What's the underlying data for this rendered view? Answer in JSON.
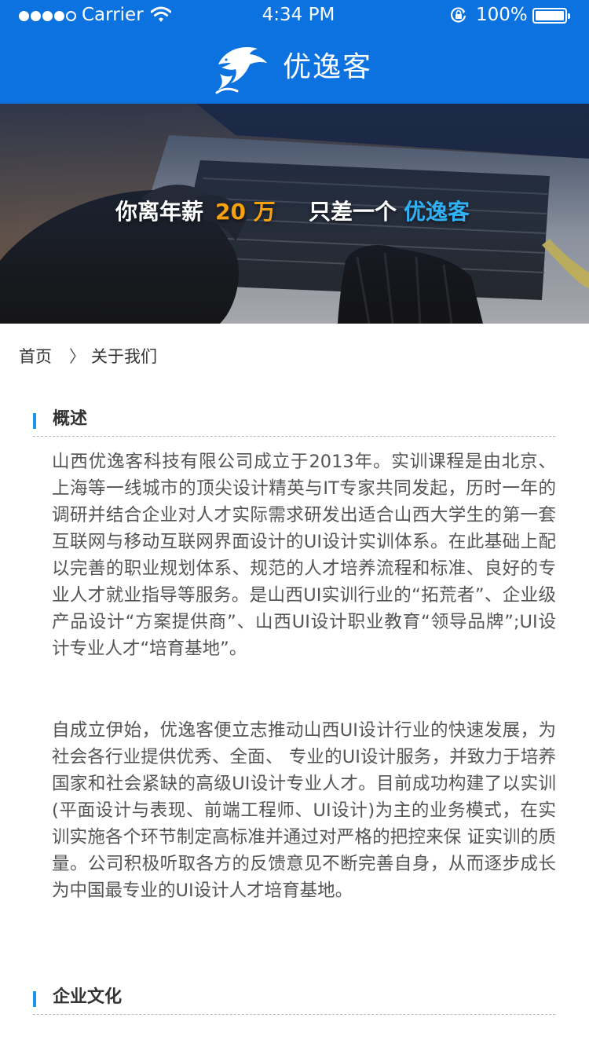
{
  "status_bar": {
    "carrier": "Carrier",
    "time": "4:34 PM",
    "battery": "100%"
  },
  "nav": {
    "title": "优逸客",
    "logo_icon": "dolphin-icon"
  },
  "hero": {
    "slogan_part1": "你离年薪",
    "slogan_number": "20 万",
    "slogan_part2": "只差一个",
    "slogan_brand": "优逸客",
    "number_color": "#f5a20e",
    "brand_color": "#2fb1f4"
  },
  "breadcrumb": {
    "home": "首页",
    "separator": "〉",
    "current": "关于我们"
  },
  "sections": {
    "overview": {
      "title": "概述",
      "paragraphs": [
        "山西优逸客科技有限公司成立于2013年。实训课程是由北京、上海等一线城市的顶尖设计精英与IT专家共同发起，历时一年的调研并结合企业对人才实际需求研发出适合山西大学生的第一套互联网与移动互联网界面设计的UI设计实训体系。在此基础上配以完善的职业规划体系、规范的人才培养流程和标准、良好的专业人才就业指导等服务。是山西UI实训行业的“拓荒者”、企业级产品设计“方案提供商”、山西UI设计职业教育“领导品牌”;UI设 计专业人才“培育基地”。",
        "自成立伊始，优逸客便立志推动山西UI设计行业的快速发展，为社会各行业提供优秀、全面、 专业的UI设计服务，并致力于培养国家和社会紧缺的高级UI设计专业人才。目前成功构建了以实训(平面设计与表现、前端工程师、UI设计)为主的业务模式，在实训实施各个环节制定高标准并通过对严格的把控来保 证实训的质量。公司积极听取各方的反馈意见不断完善自身，从而逐步成长为中国最专业的UI设计人才培育基地。"
      ]
    },
    "culture": {
      "title": "企业文化"
    }
  },
  "colors": {
    "header_blue": "#0b72e0",
    "accent_bar": "#1a95e8",
    "body_text": "#555555"
  }
}
